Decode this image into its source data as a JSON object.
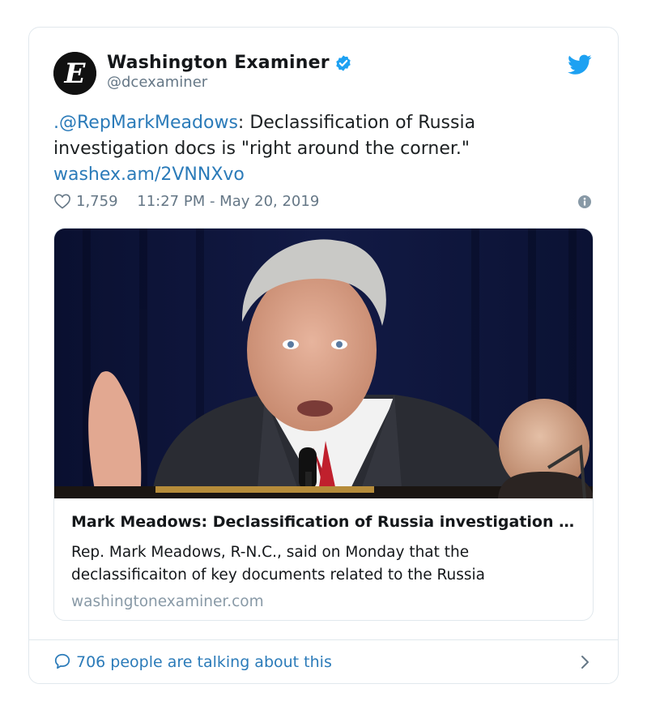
{
  "account": {
    "display_name": "Washington Examiner",
    "handle": "@dcexaminer",
    "verified": true,
    "avatar_letter": "E"
  },
  "tweet": {
    "mention": ".@RepMarkMeadows",
    "text": ": Declassification of Russia investigation docs is \"right around the corner.\"",
    "link": "washex.am/2VNNXvo"
  },
  "meta": {
    "likes": "1,759",
    "timestamp": "11:27 PM - May 20, 2019"
  },
  "link_card": {
    "title": "Mark Meadows: Declassification of Russia investigation docs is \"right around the corner\"",
    "description": "Rep. Mark Meadows, R-N.C., said on Monday that the declassificaiton of key documents related to the Russia investigation",
    "domain": "washingtonexaminer.com"
  },
  "footer": {
    "talking": "706 people are talking about this"
  },
  "colors": {
    "link_blue": "#2b7bb9",
    "verified_blue": "#1da1f2",
    "meta_gray": "#657786"
  },
  "icons": [
    "twitter-bird-icon",
    "verified-badge-icon",
    "heart-icon",
    "info-icon",
    "comment-bubble-icon",
    "chevron-right-icon"
  ]
}
